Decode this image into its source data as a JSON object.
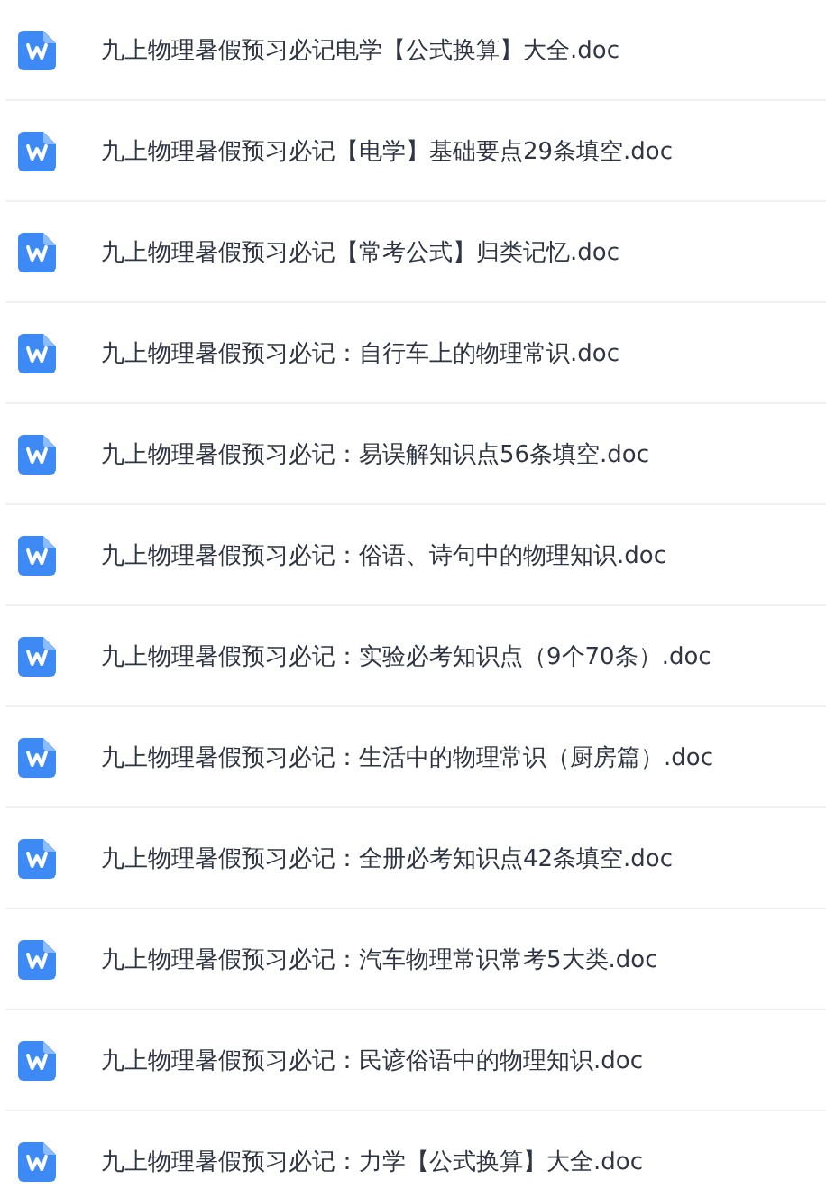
{
  "files": [
    {
      "name": "九上物理暑假预习必记电学【公式换算】大全.doc",
      "kind": "doc"
    },
    {
      "name": "九上物理暑假预习必记【电学】基础要点29条填空.doc",
      "kind": "doc"
    },
    {
      "name": "九上物理暑假预习必记【常考公式】归类记忆.doc",
      "kind": "doc"
    },
    {
      "name": "九上物理暑假预习必记：自行车上的物理常识.doc",
      "kind": "doc"
    },
    {
      "name": "九上物理暑假预习必记：易误解知识点56条填空.doc",
      "kind": "doc"
    },
    {
      "name": "九上物理暑假预习必记：俗语、诗句中的物理知识.doc",
      "kind": "doc"
    },
    {
      "name": "九上物理暑假预习必记：实验必考知识点（9个70条）.doc",
      "kind": "doc"
    },
    {
      "name": "九上物理暑假预习必记：生活中的物理常识（厨房篇）.doc",
      "kind": "doc"
    },
    {
      "name": "九上物理暑假预习必记：全册必考知识点42条填空.doc",
      "kind": "doc"
    },
    {
      "name": "九上物理暑假预习必记：汽车物理常识常考5大类.doc",
      "kind": "doc"
    },
    {
      "name": "九上物理暑假预习必记：民谚俗语中的物理知识.doc",
      "kind": "doc"
    },
    {
      "name": "九上物理暑假预习必记：力学【公式换算】大全.doc",
      "kind": "doc"
    }
  ]
}
